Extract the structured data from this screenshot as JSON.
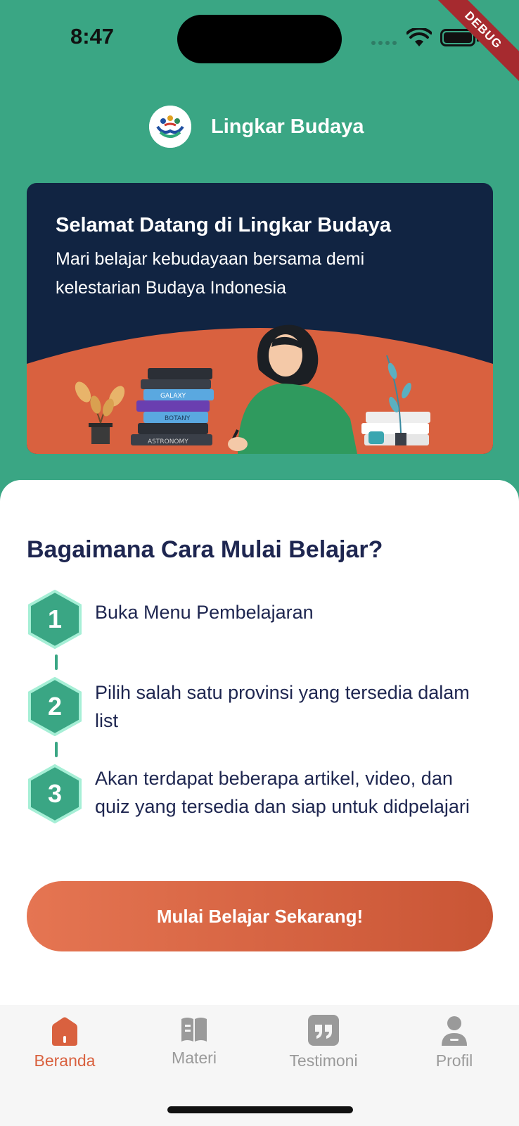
{
  "status_bar": {
    "time": "8:47",
    "debug_banner": "DEBUG"
  },
  "brand": {
    "name": "Lingkar Budaya",
    "logo_icon": "people-circle-logo-icon"
  },
  "welcome_card": {
    "title": "Selamat Datang di Lingkar Budaya",
    "subtitle": "Mari belajar kebudayaan bersama demi kelestarian Budaya Indonesia",
    "book_labels": [
      "GALAXY",
      "BOTANY",
      "ASTRONOMY"
    ]
  },
  "howto": {
    "title": "Bagaimana Cara Mulai Belajar?",
    "steps": [
      {
        "number": "1",
        "text": "Buka Menu Pembelajaran"
      },
      {
        "number": "2",
        "text": "Pilih salah satu provinsi yang tersedia dalam list"
      },
      {
        "number": "3",
        "text": "Akan terdapat beberapa artikel, video, dan quiz yang tersedia dan siap untuk didpelajari"
      }
    ]
  },
  "cta": {
    "label": "Mulai Belajar Sekarang!"
  },
  "bottom_nav": {
    "items": [
      {
        "label": "Beranda",
        "icon": "home-icon",
        "active": true
      },
      {
        "label": "Materi",
        "icon": "book-icon",
        "active": false
      },
      {
        "label": "Testimoni",
        "icon": "quote-icon",
        "active": false
      },
      {
        "label": "Profil",
        "icon": "user-icon",
        "active": false
      }
    ]
  },
  "colors": {
    "primary_green": "#3aa684",
    "navy": "#112442",
    "accent_orange": "#d9613f",
    "text_dark": "#1e2650",
    "nav_inactive": "#9a9a9a"
  }
}
